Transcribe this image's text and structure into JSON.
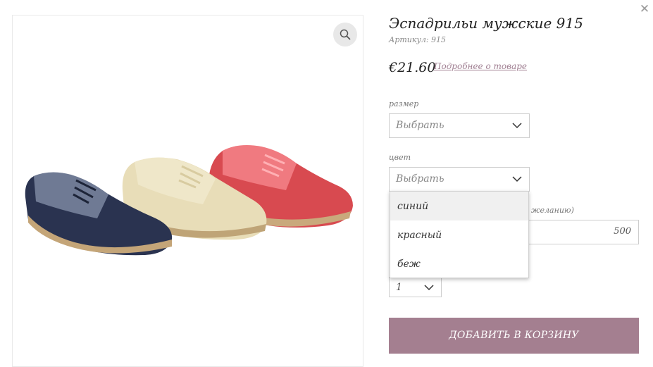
{
  "product": {
    "title": "Эспадрильи мужские 915",
    "sku": "Артикул: 915",
    "price": "€21.60",
    "more_link": "Подробнее о товаре"
  },
  "size": {
    "label": "размер",
    "value": "Выбрать"
  },
  "color": {
    "label": "цвет",
    "value": "Выбрать",
    "options": [
      "синий",
      "красный",
      "беж"
    ],
    "highlighted": "синий"
  },
  "price_field": {
    "label_tail": "желанию)",
    "value": "500"
  },
  "quantity": {
    "value": "1"
  },
  "cart_button": "ДОБАВИТЬ В КОРЗИНУ",
  "colors": {
    "accent": "#a47f90",
    "link": "#a07f92"
  }
}
